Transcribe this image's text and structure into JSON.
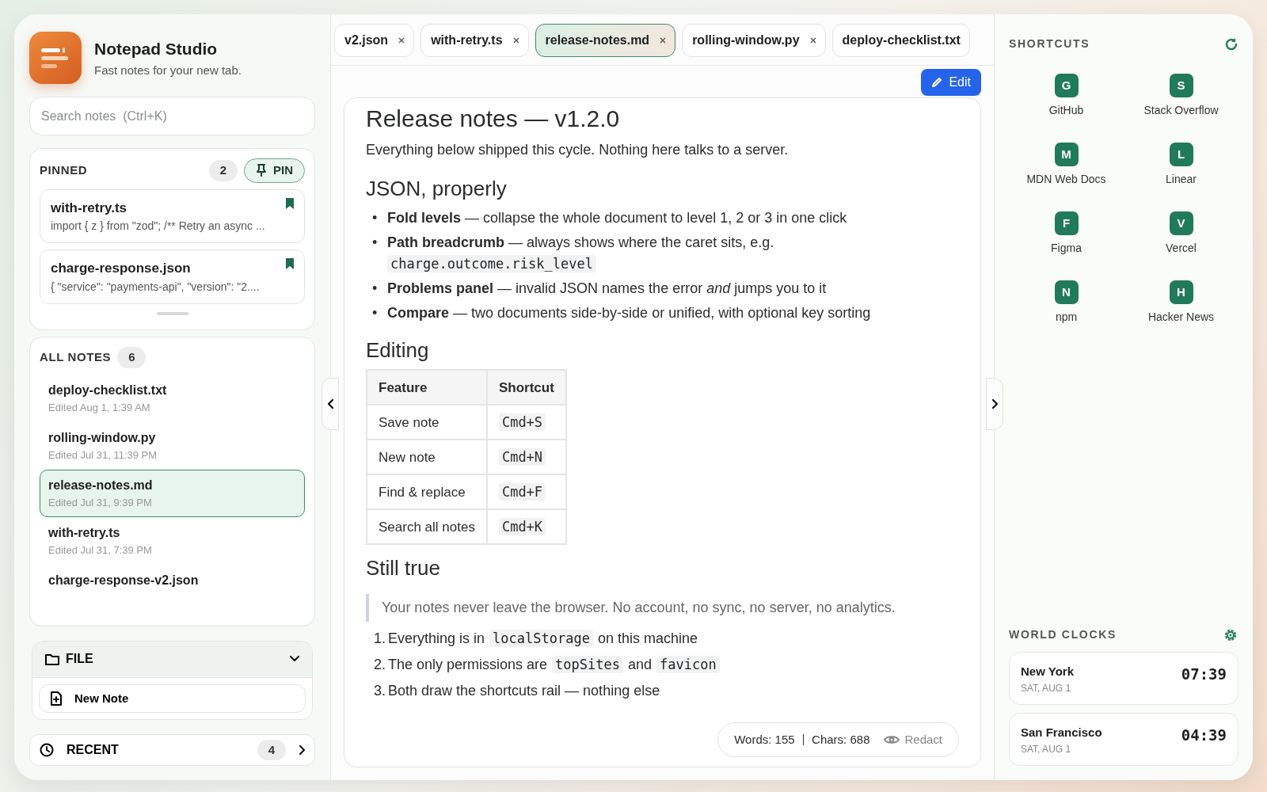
{
  "app": {
    "name": "Notepad Studio",
    "tagline": "Fast notes for your new tab."
  },
  "search": {
    "placeholder": "Search notes  (Ctrl+K)"
  },
  "pinned": {
    "title": "PINNED",
    "count": "2",
    "pin_button": "PIN",
    "items": [
      {
        "title": "with-retry.ts",
        "preview": "import { z } from \"zod\"; /** Retry an async ..."
      },
      {
        "title": "charge-response.json",
        "preview": "{ \"service\": \"payments-api\", \"version\": \"2...."
      }
    ]
  },
  "all_notes": {
    "title": "ALL NOTES",
    "count": "6",
    "items": [
      {
        "title": "deploy-checklist.txt",
        "edited": "Edited Aug 1, 1:39 AM",
        "selected": false
      },
      {
        "title": "rolling-window.py",
        "edited": "Edited Jul 31, 11:39 PM",
        "selected": false
      },
      {
        "title": "release-notes.md",
        "edited": "Edited Jul 31, 9:39 PM",
        "selected": true
      },
      {
        "title": "with-retry.ts",
        "edited": "Edited Jul 31, 7:39 PM",
        "selected": false
      },
      {
        "title": "charge-response-v2.json",
        "selected": false
      }
    ]
  },
  "file_menu": {
    "label": "FILE",
    "expanded": true,
    "items": [
      {
        "label": "New Note"
      }
    ]
  },
  "recent": {
    "label": "RECENT",
    "count": "4"
  },
  "tabs": [
    {
      "label": "v2.json",
      "selected": false
    },
    {
      "label": "with-retry.ts",
      "selected": false
    },
    {
      "label": "release-notes.md",
      "selected": true
    },
    {
      "label": "rolling-window.py",
      "selected": false
    },
    {
      "label": "deploy-checklist.txt",
      "selected": false
    }
  ],
  "edit_button": "Edit",
  "document": [
    {
      "kind": "title",
      "text": "Release notes — v1.2.0"
    },
    {
      "kind": "paragraph",
      "text": "Everything below shipped this cycle. Nothing here talks to a server."
    },
    {
      "kind": "heading",
      "text": "JSON, properly"
    },
    {
      "kind": "bullets",
      "items": [
        {
          "marker": "•",
          "term": "Fold levels",
          "text": "— collapse the whole document to level 1, 2 or 3 in one click"
        },
        {
          "marker": "•",
          "term": "Path breadcrumb",
          "text": "— always shows where the caret sits, e.g.",
          "code": "charge.outcome.risk_level"
        },
        {
          "marker": "•",
          "term": "Problems panel",
          "text": "— invalid JSON names the error *and* jumps you to it"
        },
        {
          "marker": "•",
          "term": "Compare",
          "text": "— two documents side-by-side or unified, with optional key sorting"
        }
      ]
    },
    {
      "kind": "heading",
      "text": "Editing"
    },
    {
      "kind": "table",
      "columns": [
        {
          "label": "Feature",
          "kind": "text"
        },
        {
          "label": "Shortcut",
          "kind": "key"
        }
      ],
      "rows": [
        [
          "Save note",
          "Cmd+S"
        ],
        [
          "New note",
          "Cmd+N"
        ],
        [
          "Find & replace",
          "Cmd+F"
        ],
        [
          "Search all notes",
          "Cmd+K"
        ]
      ]
    },
    {
      "kind": "heading",
      "text": "Still true"
    },
    {
      "kind": "quote",
      "text": "Your notes never leave the browser. No account, no sync, no server, no analytics."
    },
    {
      "kind": "ordered",
      "items": [
        {
          "marker": "1.",
          "parts": [
            {
              "kind": "text",
              "text": "Everything is in"
            },
            {
              "kind": "code",
              "text": "localStorage"
            },
            {
              "kind": "text",
              "text": "on this machine"
            }
          ]
        },
        {
          "marker": "2.",
          "parts": [
            {
              "kind": "text",
              "text": "The only permissions are"
            },
            {
              "kind": "code",
              "text": "topSites"
            },
            {
              "kind": "text",
              "text": "and"
            },
            {
              "kind": "code",
              "text": "favicon"
            }
          ]
        },
        {
          "marker": "3.",
          "parts": [
            {
              "kind": "text",
              "text": "Both draw the shortcuts rail — nothing else"
            }
          ]
        }
      ]
    }
  ],
  "status": {
    "words": "Words: 155",
    "chars": "Chars: 688",
    "redact": "Redact"
  },
  "shortcuts": {
    "title": "SHORTCUTS",
    "items": [
      {
        "letter": "G",
        "label": "GitHub"
      },
      {
        "letter": "S",
        "label": "Stack Overflow"
      },
      {
        "letter": "M",
        "label": "MDN Web Docs"
      },
      {
        "letter": "L",
        "label": "Linear"
      },
      {
        "letter": "F",
        "label": "Figma"
      },
      {
        "letter": "V",
        "label": "Vercel"
      },
      {
        "letter": "N",
        "label": "npm"
      },
      {
        "letter": "H",
        "label": "Hacker News"
      }
    ]
  },
  "world_clocks": {
    "title": "WORLD CLOCKS",
    "items": [
      {
        "city": "New York",
        "date": "SAT, AUG 1",
        "time": "07:39"
      },
      {
        "city": "San Francisco",
        "date": "SAT, AUG 1",
        "time": "04:39"
      }
    ]
  }
}
